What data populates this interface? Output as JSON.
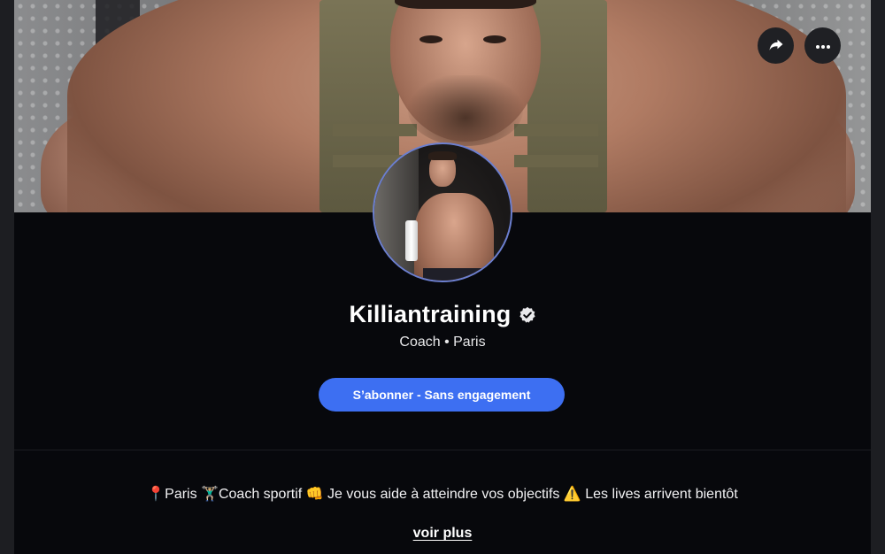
{
  "profile": {
    "name": "Killiantraining",
    "subtitle": "Coach • Paris",
    "verified": true
  },
  "actions": {
    "share_icon": "share-arrow-icon",
    "more_icon": "more-horizontal-icon",
    "subscribe_label": "S’abonner - Sans engagement"
  },
  "bio": {
    "text": "📍Paris 🏋🏼‍♂️Coach sportif 👊 Je vous aide à atteindre vos objectifs ⚠️ Les lives arrivent bientôt",
    "more_label": "voir plus"
  },
  "colors": {
    "background": "#07080c",
    "accent": "#3d6ff2",
    "button_dark": "#1f2024"
  }
}
